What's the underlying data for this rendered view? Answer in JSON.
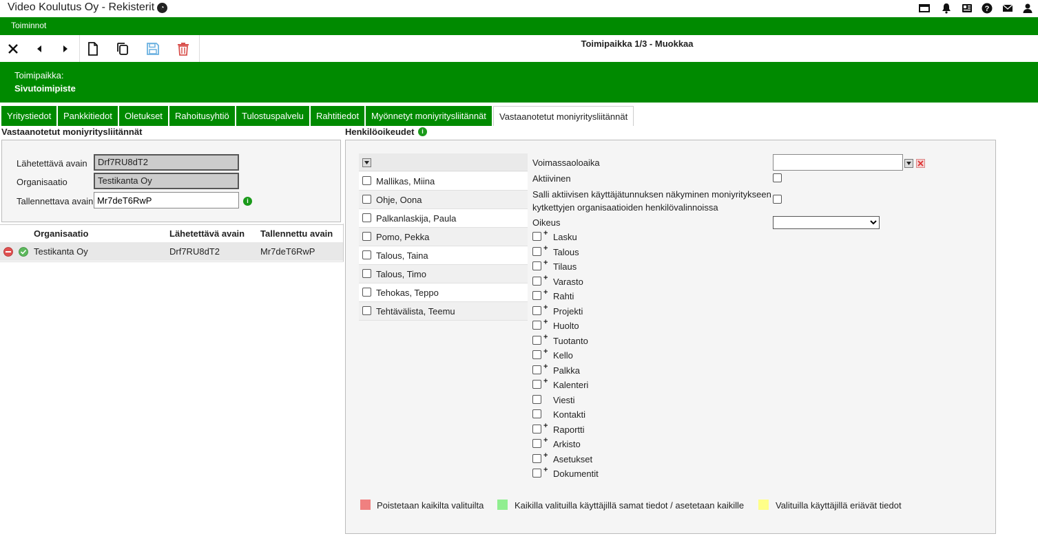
{
  "app": {
    "title": "Video Koulutus Oy - Rekisterit"
  },
  "menu": {
    "label": "Toiminnot"
  },
  "toolbar": {
    "title": "Toimipaikka 1/3 - Muokkaa"
  },
  "header": {
    "label": "Toimipaikka:",
    "value": "Sivutoimipiste"
  },
  "tabs": [
    {
      "label": "Yritystiedot"
    },
    {
      "label": "Pankkitiedot"
    },
    {
      "label": "Oletukset"
    },
    {
      "label": "Rahoitusyhtiö"
    },
    {
      "label": "Tulostuspalvelu"
    },
    {
      "label": "Rahtitiedot"
    },
    {
      "label": "Myönnetyt moniyritysliitännät"
    },
    {
      "label": "Vastaanotetut moniyritysliitännät"
    }
  ],
  "left": {
    "title": "Vastaanotetut moniyritysliitännät",
    "form": {
      "sent_key_label": "Lähetettävä avain",
      "sent_key_value": "Drf7RU8dT2",
      "org_label": "Organisaatio",
      "org_value": "Testikanta Oy",
      "save_key_label": "Tallennettava avain",
      "save_key_value": "Mr7deT6RwP"
    },
    "table": {
      "headers": [
        "Organisaatio",
        "Lähetettävä avain",
        "Tallennettu avain"
      ],
      "rows": [
        {
          "org": "Testikanta Oy",
          "sent": "Drf7RU8dT2",
          "saved": "Mr7deT6RwP"
        }
      ]
    }
  },
  "right": {
    "title": "Henkilöoikeudet",
    "users": [
      "Mallikas, Miina",
      "Ohje, Oona",
      "Palkanlaskija, Paula",
      "Pomo, Pekka",
      "Talous, Taina",
      "Talous, Timo",
      "Tehokas, Teppo",
      "Tehtävälista, Teemu"
    ],
    "validity_label": "Voimassaoloaika",
    "active_label": "Aktiivinen",
    "allow_label_1": "Salli aktiivisen käyttäjätunnuksen näkyminen moniyritykseen",
    "allow_label_2": "kytkettyjen organisaatioiden henkilövalinnoissa",
    "rights_label": "Oikeus",
    "rights": [
      {
        "label": "Lasku",
        "plus": true
      },
      {
        "label": "Talous",
        "plus": true
      },
      {
        "label": "Tilaus",
        "plus": true
      },
      {
        "label": "Varasto",
        "plus": true
      },
      {
        "label": "Rahti",
        "plus": true
      },
      {
        "label": "Projekti",
        "plus": true
      },
      {
        "label": "Huolto",
        "plus": true
      },
      {
        "label": "Tuotanto",
        "plus": true
      },
      {
        "label": "Kello",
        "plus": true
      },
      {
        "label": "Palkka",
        "plus": true
      },
      {
        "label": "Kalenteri",
        "plus": true
      },
      {
        "label": "Viesti",
        "plus": false
      },
      {
        "label": "Kontakti",
        "plus": false
      },
      {
        "label": "Raportti",
        "plus": true
      },
      {
        "label": "Arkisto",
        "plus": true
      },
      {
        "label": "Asetukset",
        "plus": true
      },
      {
        "label": "Dokumentit",
        "plus": true
      }
    ],
    "legend": [
      {
        "label": "Poistetaan kaikilta valituilta",
        "color": "#f08080"
      },
      {
        "label": "Kaikilla valituilla käyttäjillä samat tiedot / asetetaan kaikille",
        "color": "#90ee90"
      },
      {
        "label": "Valituilla käyttäjillä eriävät tiedot",
        "color": "#ffff88"
      }
    ]
  },
  "colors": {
    "brand": "#008a00"
  }
}
